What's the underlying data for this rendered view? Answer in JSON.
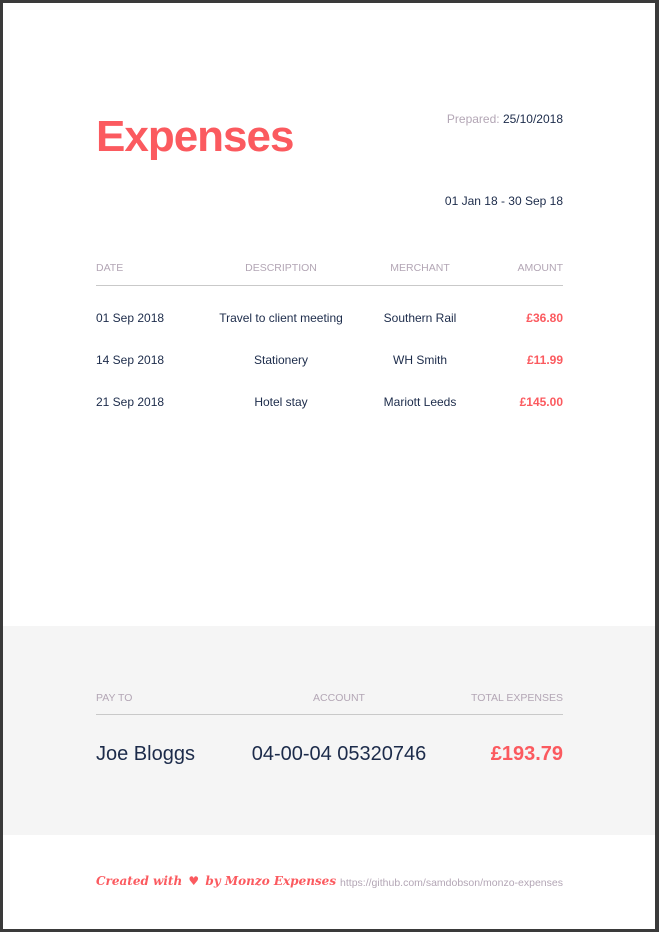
{
  "header": {
    "title": "Expenses",
    "prepared_label": "Prepared:",
    "prepared_date": "25/10/2018",
    "date_range": "01 Jan 18 - 30 Sep 18"
  },
  "table": {
    "columns": [
      "DATE",
      "DESCRIPTION",
      "MERCHANT",
      "AMOUNT"
    ],
    "rows": [
      {
        "date": "01 Sep 2018",
        "description": "Travel to client meeting",
        "merchant": "Southern Rail",
        "amount": "£36.80"
      },
      {
        "date": "14 Sep 2018",
        "description": "Stationery",
        "merchant": "WH Smith",
        "amount": "£11.99"
      },
      {
        "date": "21 Sep 2018",
        "description": "Hotel stay",
        "merchant": "Mariott Leeds",
        "amount": "£145.00"
      }
    ]
  },
  "summary": {
    "pay_to_label": "PAY TO",
    "account_label": "ACCOUNT",
    "total_label": "TOTAL EXPENSES",
    "pay_to": "Joe Bloggs",
    "account": "04-00-04 05320746",
    "total": "£193.79"
  },
  "footer": {
    "created_prefix": "Created with",
    "heart": "♥",
    "created_suffix": "by Monzo Expenses",
    "url": "https://github.com/samdobson/monzo-expenses"
  },
  "colors": {
    "accent": "#fb5a5f",
    "text": "#1c2b4a",
    "muted": "#b3a6b5",
    "summary_bg": "#f5f5f5"
  }
}
